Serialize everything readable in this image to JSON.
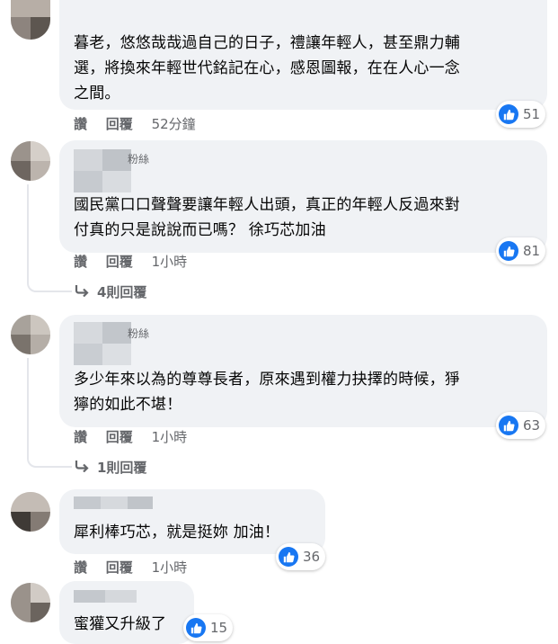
{
  "colors": {
    "like_blue": "#1877f2",
    "bubble": "#f0f2f5",
    "meta": "#65676b"
  },
  "comments": [
    {
      "text_lines": [
        "暮老，悠悠哉哉過自己的日子，禮讓年輕人，甚至鼎力輔",
        "選，將換來年輕世代銘記在心，感恩圖報，在在人心一念",
        "之間。"
      ],
      "reactions": "51",
      "actions": {
        "like": "讚",
        "reply": "回覆",
        "time": "52分鐘"
      }
    },
    {
      "name_suffix": "粉絲",
      "text_lines": [
        "國民黨口口聲聲要讓年輕人出頭，真正的年輕人反過來對",
        "付真的只是說說而已嗎？ 徐巧芯加油"
      ],
      "reactions": "81",
      "actions": {
        "like": "讚",
        "reply": "回覆",
        "time": "1小時"
      },
      "replies": "4則回覆"
    },
    {
      "name_suffix": "粉絲",
      "text_lines": [
        "多少年來以為的尊尊長者，原來遇到權力抉擇的時候，猙",
        "獰的如此不堪！"
      ],
      "reactions": "63",
      "actions": {
        "like": "讚",
        "reply": "回覆",
        "time": "1小時"
      },
      "replies": "1則回覆"
    },
    {
      "text_lines": [
        "犀利棒巧芯，就是挺妳 加油！"
      ],
      "reactions": "36",
      "actions": {
        "like": "讚",
        "reply": "回覆",
        "time": "1小時"
      }
    },
    {
      "text_lines": [
        "蜜獾又升級了"
      ],
      "reactions": "15"
    }
  ]
}
